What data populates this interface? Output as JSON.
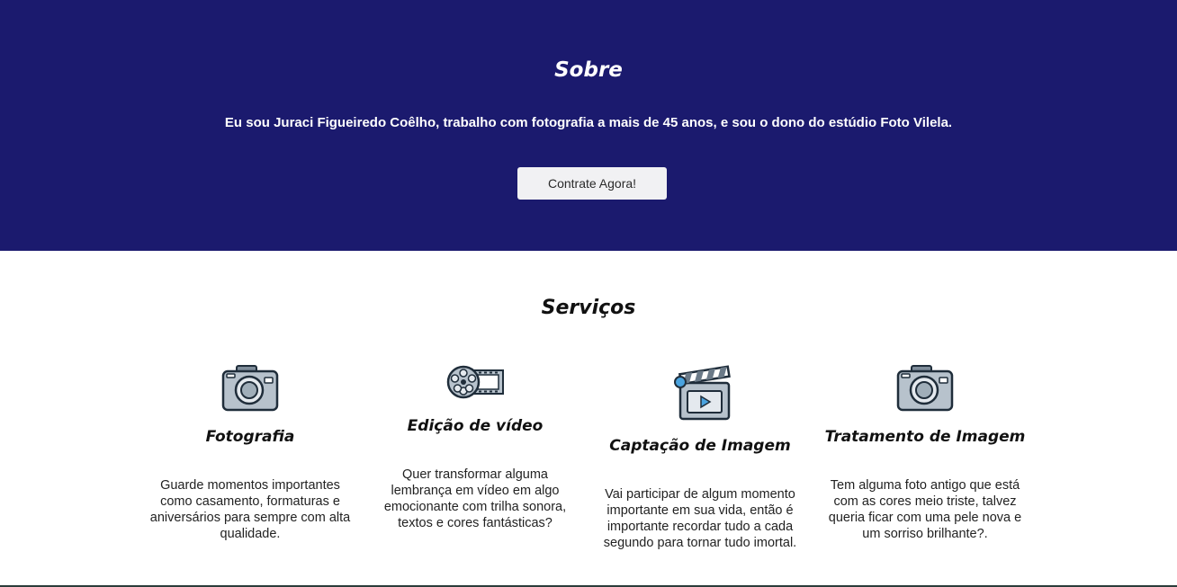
{
  "about": {
    "title": "Sobre",
    "text": "Eu sou Juraci Figueiredo Coêlho, trabalho com fotografia a mais de 45 anos, e sou o dono do estúdio Foto Vilela.",
    "button_label": "Contrate Agora!",
    "background_color": "#1b1a6e"
  },
  "services": {
    "title": "Serviços",
    "items": [
      {
        "icon": "camera-icon",
        "title": "Fotografia",
        "text": "Guarde momentos importantes como casamento, formaturas e aniversários para sempre com alta qualidade."
      },
      {
        "icon": "film-reel-icon",
        "title": "Edição de vídeo",
        "text": "Quer transformar alguma lembrança em vídeo em algo emocionante com trilha sonora, textos e cores fantásticas?"
      },
      {
        "icon": "clapperboard-icon",
        "title": "Captação de Imagem",
        "text": "Vai participar de algum momento importante em sua vida, então é importante recordar tudo a cada segundo para tornar tudo imortal."
      },
      {
        "icon": "camera-icon",
        "title": "Tratamento de Imagem",
        "text": "Tem alguma foto antigo que está com as cores meio triste, talvez queria ficar com uma pele nova e um sorriso brilhante?."
      }
    ]
  }
}
